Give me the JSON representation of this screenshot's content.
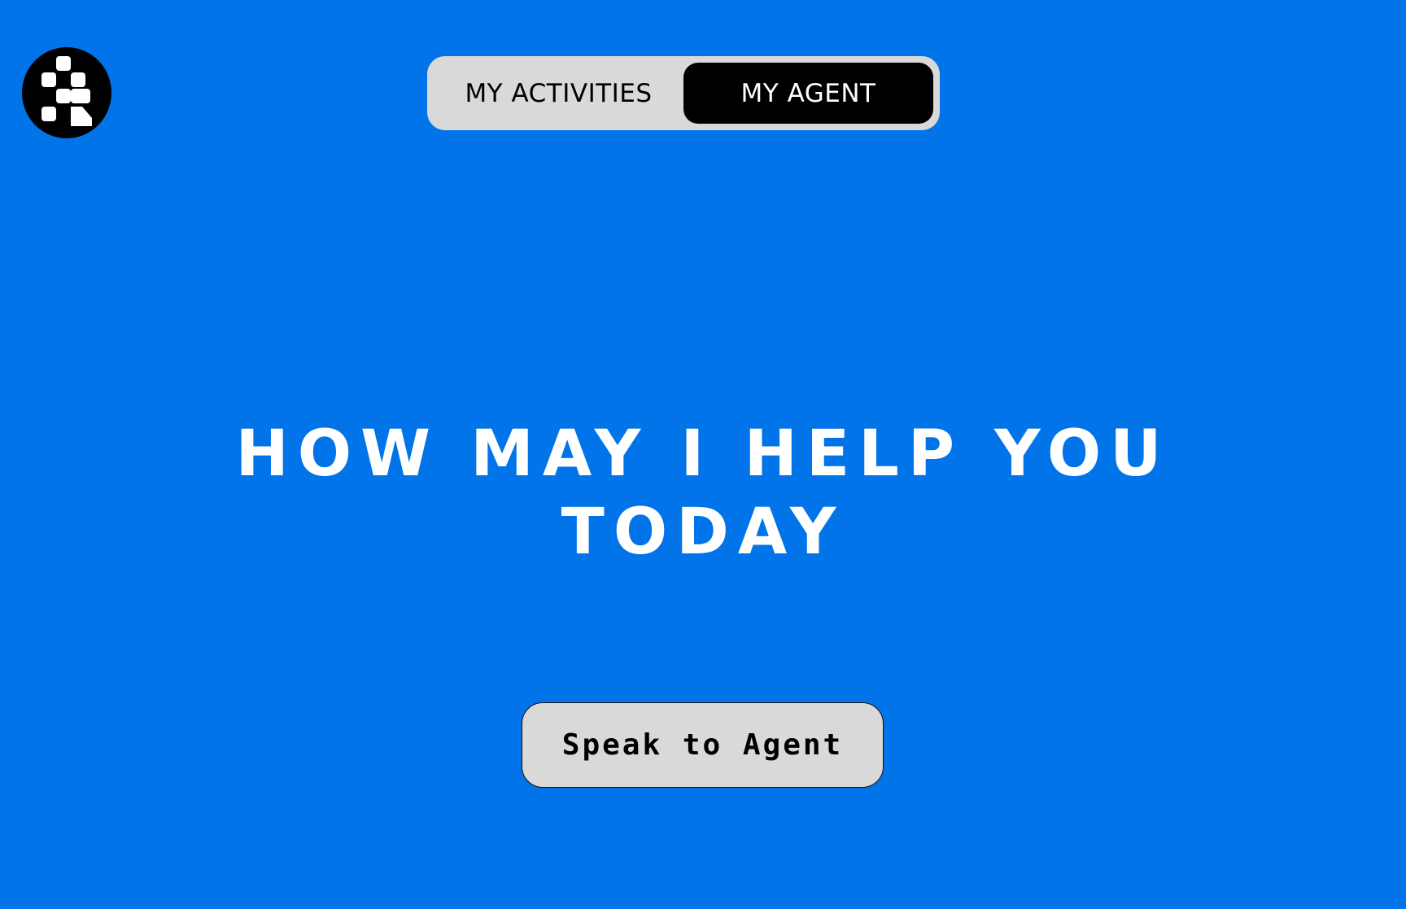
{
  "app": {
    "logo_icon": "checker-person-logo-icon",
    "background_color": "#0074E8"
  },
  "tabs": [
    {
      "label": "MY ACTIVITIES",
      "active": false
    },
    {
      "label": "MY AGENT",
      "active": true
    }
  ],
  "main": {
    "headline_line1": "HOW MAY I HELP YOU",
    "headline_line2": "TODAY",
    "speak_button_label": "Speak to Agent"
  }
}
